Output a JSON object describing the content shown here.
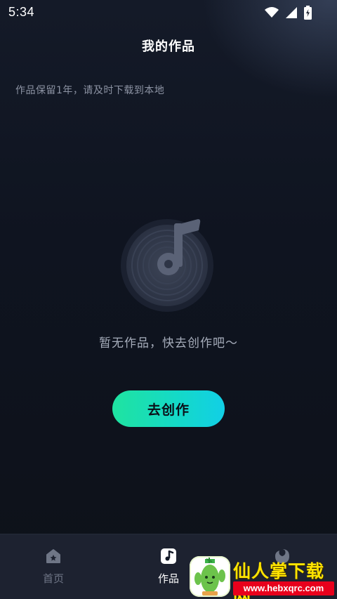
{
  "status_bar": {
    "time": "5:34",
    "icons": [
      "wifi-icon",
      "signal-icon",
      "battery-charging-icon"
    ]
  },
  "header": {
    "title": "我的作品"
  },
  "notice": "作品保留1年，请及时下载到本地",
  "empty_state": {
    "icon": "music-disc-icon",
    "message": "暂无作品，快去创作吧～",
    "button_label": "去创作"
  },
  "bottom_nav": {
    "items": [
      {
        "label": "首页",
        "icon": "home-icon",
        "active": false
      },
      {
        "label": "作品",
        "icon": "music-note-icon",
        "active": true
      },
      {
        "label": "",
        "icon": "profile-icon",
        "active": false
      }
    ]
  },
  "watermark": {
    "title": "仙人掌下载网",
    "url": "www.hebxqrc.com"
  },
  "colors": {
    "accent_start": "#1fe3a0",
    "accent_end": "#12cfe6",
    "background": "#0d1119",
    "nav_background": "#1d2230"
  }
}
